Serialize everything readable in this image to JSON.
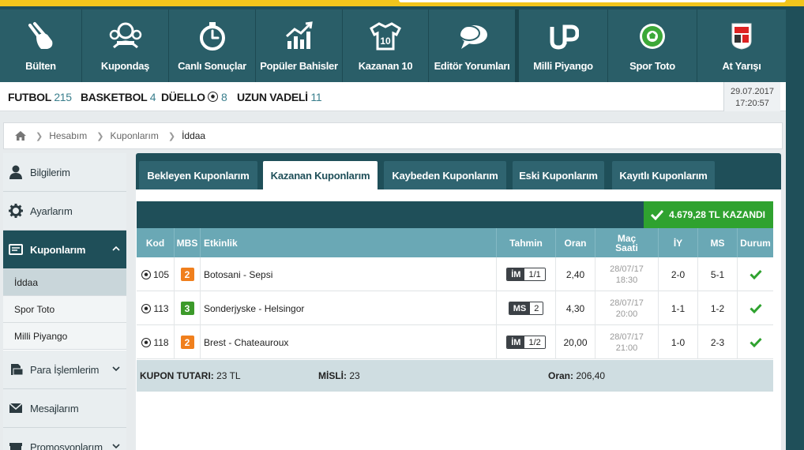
{
  "top_nav": [
    {
      "label": "Bülten",
      "icon": "hand-touch-icon"
    },
    {
      "label": "Kupondaş",
      "icon": "users-group-icon"
    },
    {
      "label": "Canlı Sonuçlar",
      "icon": "stopwatch-icon"
    },
    {
      "label": "Popüler Bahisler",
      "icon": "trend-chart-icon"
    },
    {
      "label": "Kazanan 10",
      "icon": "jersey-10-icon"
    },
    {
      "label": "Editör Yorumları",
      "icon": "speech-bubbles-icon"
    },
    {
      "label": "Milli Piyango",
      "icon": "mp-logo-icon"
    },
    {
      "label": "Spor Toto",
      "icon": "soccer-ball-icon"
    },
    {
      "label": "At Yarışı",
      "icon": "tjk-logo-icon"
    }
  ],
  "sports": [
    {
      "name": "FUTBOL",
      "count": "215"
    },
    {
      "name": "BASKETBOL",
      "count": "4"
    },
    {
      "name": "DÜELLO",
      "count": "8"
    },
    {
      "name": "UZUN VADELİ",
      "count": "11"
    }
  ],
  "datetime": {
    "date": "29.07.2017",
    "time": "17:20:57"
  },
  "breadcrumb": {
    "items": [
      "Hesabım",
      "Kuponlarım"
    ],
    "current": "İddaa"
  },
  "sidebar": {
    "items": [
      {
        "label": "Bilgilerim"
      },
      {
        "label": "Ayarlarım"
      },
      {
        "label": "Kuponlarım"
      },
      {
        "label": "Para İşlemlerim"
      },
      {
        "label": "Mesajlarım"
      },
      {
        "label": "Promosyonlarım"
      }
    ],
    "sub_items": [
      "İddaa",
      "Spor Toto",
      "Milli Piyango"
    ]
  },
  "tabs": [
    "Bekleyen Kuponlarım",
    "Kazanan Kuponlarım",
    "Kaybeden Kuponlarım",
    "Eski Kuponlarım",
    "Kayıtlı Kuponlarım"
  ],
  "won_banner": "4.679,28 TL KAZANDI",
  "columns": {
    "kod": "Kod",
    "mbs": "MBS",
    "etkinlik": "Etkinlik",
    "tahmin": "Tahmin",
    "oran": "Oran",
    "mac_saati_1": "Maç",
    "mac_saati_2": "Saati",
    "iy": "İY",
    "ms": "MS",
    "durum": "Durum"
  },
  "rows": [
    {
      "kod": "105",
      "mbs": "2",
      "mbs_color": "#f07f1d",
      "etkinlik": "Botosani - Sepsi",
      "tahmin_code": "İM",
      "tahmin_value": "1/1",
      "oran": "2,40",
      "date": "28/07/17",
      "time": "18:30",
      "iy": "2-0",
      "ms": "5-1"
    },
    {
      "kod": "113",
      "mbs": "3",
      "mbs_color": "#3c9a2a",
      "etkinlik": "Sonderjyske - Helsingor",
      "tahmin_code": "MS",
      "tahmin_value": "2",
      "oran": "4,30",
      "date": "28/07/17",
      "time": "20:00",
      "iy": "1-1",
      "ms": "1-2"
    },
    {
      "kod": "118",
      "mbs": "2",
      "mbs_color": "#f07f1d",
      "etkinlik": "Brest - Chateauroux",
      "tahmin_code": "İM",
      "tahmin_value": "1/2",
      "oran": "20,00",
      "date": "28/07/17",
      "time": "21:00",
      "iy": "1-0",
      "ms": "2-3"
    }
  ],
  "summary": {
    "tutar_label": "KUPON TUTARI:",
    "tutar_value": "23 TL",
    "misli_label": "MİSLİ:",
    "misli_value": "23",
    "oran_label": "Oran:",
    "oran_value": "206,40"
  },
  "colors": {
    "primary": "#1f4f59",
    "accent": "#2fa22f",
    "header": "#6aa8b5",
    "brand_yellow": "#f2c51c"
  }
}
